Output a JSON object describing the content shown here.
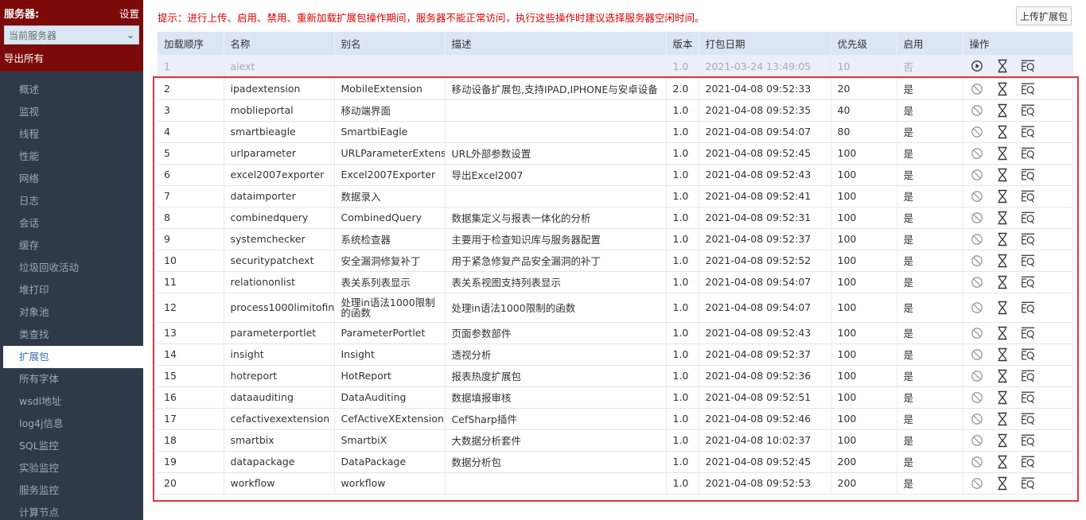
{
  "sidebar": {
    "title": "服务器:",
    "settings": "设置",
    "server_select": "当前服务器",
    "export_all": "导出所有",
    "items": [
      {
        "label": "概述"
      },
      {
        "label": "监视"
      },
      {
        "label": "线程"
      },
      {
        "label": "性能"
      },
      {
        "label": "网络"
      },
      {
        "label": "日志"
      },
      {
        "label": "会话"
      },
      {
        "label": "缓存"
      },
      {
        "label": "垃圾回收活动"
      },
      {
        "label": "堆打印"
      },
      {
        "label": "对象池"
      },
      {
        "label": "类查找"
      },
      {
        "label": "扩展包",
        "active": true
      },
      {
        "label": "所有字体"
      },
      {
        "label": "wsdl地址"
      },
      {
        "label": "log4j信息"
      },
      {
        "label": "SQL监控"
      },
      {
        "label": "实验监控"
      },
      {
        "label": "服务监控"
      },
      {
        "label": "计算节点"
      }
    ]
  },
  "main": {
    "hint": "提示：进行上传、启用、禁用、重新加载扩展包操作期间，服务器不能正常访问，执行这些操作时建议选择服务器空闲时间。",
    "upload_button": "上传扩展包",
    "columns": [
      "加载顺序",
      "名称",
      "别名",
      "描述",
      "版本",
      "打包日期",
      "优先级",
      "启用",
      "操作"
    ],
    "rows": [
      {
        "order": "1",
        "name": "aiext",
        "alias": "",
        "desc": "",
        "version": "1.0",
        "date": "2021-03-24 13:49:05",
        "priority": "10",
        "enabled": "否",
        "disabled_row": true
      },
      {
        "order": "2",
        "name": "ipadextension",
        "alias": "MobileExtension",
        "desc": "移动设备扩展包,支持IPAD,IPHONE与安卓设备",
        "version": "2.0",
        "date": "2021-04-08 09:52:33",
        "priority": "20",
        "enabled": "是"
      },
      {
        "order": "3",
        "name": "moblieportal",
        "alias": "移动端界面",
        "desc": "",
        "version": "1.0",
        "date": "2021-04-08 09:52:35",
        "priority": "40",
        "enabled": "是"
      },
      {
        "order": "4",
        "name": "smartbieagle",
        "alias": "SmartbiEagle",
        "desc": "",
        "version": "1.0",
        "date": "2021-04-08 09:54:07",
        "priority": "80",
        "enabled": "是"
      },
      {
        "order": "5",
        "name": "urlparameter",
        "alias": "URLParameterExtension",
        "desc": "URL外部参数设置",
        "version": "1.0",
        "date": "2021-04-08 09:52:45",
        "priority": "100",
        "enabled": "是"
      },
      {
        "order": "6",
        "name": "excel2007exporter",
        "alias": "Excel2007Exporter",
        "desc": "导出Excel2007",
        "version": "1.0",
        "date": "2021-04-08 09:52:43",
        "priority": "100",
        "enabled": "是"
      },
      {
        "order": "7",
        "name": "dataimporter",
        "alias": "数据录入",
        "desc": "",
        "version": "1.0",
        "date": "2021-04-08 09:52:41",
        "priority": "100",
        "enabled": "是"
      },
      {
        "order": "8",
        "name": "combinedquery",
        "alias": "CombinedQuery",
        "desc": "数据集定义与报表一体化的分析",
        "version": "1.0",
        "date": "2021-04-08 09:52:31",
        "priority": "100",
        "enabled": "是"
      },
      {
        "order": "9",
        "name": "systemchecker",
        "alias": "系统检查器",
        "desc": "主要用于检查知识库与服务器配置",
        "version": "1.0",
        "date": "2021-04-08 09:52:37",
        "priority": "100",
        "enabled": "是"
      },
      {
        "order": "10",
        "name": "securitypatchext",
        "alias": "安全漏洞修复补丁",
        "desc": "用于紧急修复产品安全漏洞的补丁",
        "version": "1.0",
        "date": "2021-04-08 09:52:52",
        "priority": "100",
        "enabled": "是"
      },
      {
        "order": "11",
        "name": "relationonlist",
        "alias": "表关系列表显示",
        "desc": "表关系视图支持列表显示",
        "version": "1.0",
        "date": "2021-04-08 09:54:07",
        "priority": "100",
        "enabled": "是"
      },
      {
        "order": "12",
        "name": "process1000limitofin",
        "alias": "处理in语法1000限制的函数",
        "desc": "处理in语法1000限制的函数",
        "version": "1.0",
        "date": "2021-04-08 09:54:07",
        "priority": "100",
        "enabled": "是",
        "tall": true
      },
      {
        "order": "13",
        "name": "parameterportlet",
        "alias": "ParameterPortlet",
        "desc": "页面参数部件",
        "version": "1.0",
        "date": "2021-04-08 09:52:43",
        "priority": "100",
        "enabled": "是"
      },
      {
        "order": "14",
        "name": "insight",
        "alias": "Insight",
        "desc": "透视分析",
        "version": "1.0",
        "date": "2021-04-08 09:52:37",
        "priority": "100",
        "enabled": "是"
      },
      {
        "order": "15",
        "name": "hotreport",
        "alias": "HotReport",
        "desc": "报表热度扩展包",
        "version": "1.0",
        "date": "2021-04-08 09:52:36",
        "priority": "100",
        "enabled": "是"
      },
      {
        "order": "16",
        "name": "dataauditing",
        "alias": "DataAuditing",
        "desc": "数据填报审核",
        "version": "1.0",
        "date": "2021-04-08 09:52:51",
        "priority": "100",
        "enabled": "是"
      },
      {
        "order": "17",
        "name": "cefactivexextension",
        "alias": "CefActiveXExtension",
        "desc": "CefSharp插件",
        "version": "1.0",
        "date": "2021-04-08 09:52:46",
        "priority": "100",
        "enabled": "是"
      },
      {
        "order": "18",
        "name": "smartbix",
        "alias": "SmartbiX",
        "desc": "大数据分析套件",
        "version": "1.0",
        "date": "2021-04-08 10:02:37",
        "priority": "100",
        "enabled": "是"
      },
      {
        "order": "19",
        "name": "datapackage",
        "alias": "DataPackage",
        "desc": "数据分析包",
        "version": "1.0",
        "date": "2021-04-08 09:52:45",
        "priority": "200",
        "enabled": "是"
      },
      {
        "order": "20",
        "name": "workflow",
        "alias": "workflow",
        "desc": "",
        "version": "1.0",
        "date": "2021-04-08 09:52:53",
        "priority": "200",
        "enabled": "是"
      }
    ]
  },
  "colors": {
    "sidebar_bg": "#2e3a4a",
    "sidebar_top": "#7d0a0a",
    "hint_red": "#e00000",
    "header_blue": "#dbe5f6",
    "highlight_red": "#e0363c"
  }
}
